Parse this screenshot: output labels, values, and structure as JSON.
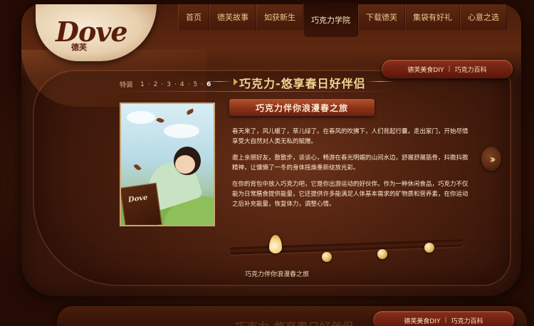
{
  "brand": {
    "logo_text": "Dove",
    "logo_cn": "德芙"
  },
  "nav": {
    "items": [
      {
        "label": "首页"
      },
      {
        "label": "德芙故事"
      },
      {
        "label": "如获新生"
      },
      {
        "label": "巧克力学院",
        "active": true
      },
      {
        "label": "下载德芙"
      },
      {
        "label": "集袋有好礼"
      },
      {
        "label": "心意之选"
      }
    ]
  },
  "category_tabs": {
    "first": "德芙美食DIY",
    "second": "巧克力百科"
  },
  "pager": {
    "label": "特调",
    "pages": [
      "1",
      "2",
      "3",
      "4",
      "5",
      "6"
    ],
    "current": "6"
  },
  "feature": {
    "title": "巧克力-悠享春日好伴侣",
    "subtitle": "巧克力伴你浪漫春之旅",
    "illustration_label": "Dove",
    "paragraphs": [
      "春天来了，风儿暖了，草儿绿了。在春风的吹拂下，人们背起行囊，走出家门，开始尽情享受大自然对人类无私的赋赠。",
      "邀上亲朋好友，散散步，谈谈心，畅游在春光明媚的山间水边，舒展舒展筋骨，抖擞抖擞精神，让慵懒了一冬的身体摇煥重新绽放光彩。",
      "在你的背包中放入巧克力吧，它是你出游运动的好伙伴。作为一种休闲食品，巧克力不仅能为日常膳食提供能量，它还提供许多能满足人体基本需求的矿物质和营养素，在你运动之后补充能量，恢复体力，调整心情。"
    ],
    "next_icon": "double-chevron-right-icon"
  },
  "timeline": {
    "caption": "巧克力伴你浪漫春之旅",
    "active_index": 0,
    "stops": 5
  },
  "bottom_preview": {
    "title": "巧克力-悠享春日好伴侣"
  },
  "colors": {
    "chocolate_dark": "#2a0f06",
    "chocolate_mid": "#5e2810",
    "gold": "#d9a24f",
    "cream": "#f7ead7",
    "banner_red": "#8a3118"
  }
}
